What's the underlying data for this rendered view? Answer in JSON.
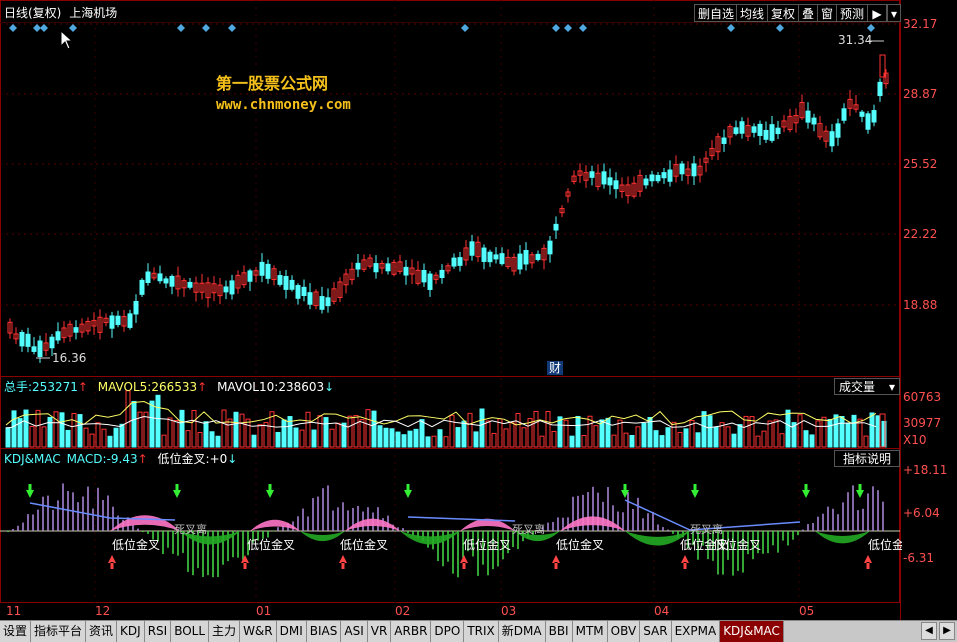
{
  "header": {
    "title": "日线(复权)",
    "stock": "上海机场"
  },
  "toolbar": {
    "del_self": "删自选",
    "ma_line": "均线",
    "fuquan": "复权",
    "overlay": "叠",
    "window": "窗",
    "forecast": "预测"
  },
  "watermark": {
    "line1": "第一股票公式网",
    "line2": "www.chnmoney.com"
  },
  "price_axis": [
    "32.17",
    "28.87",
    "25.52",
    "22.22",
    "18.88"
  ],
  "price_high_label": "31.34",
  "price_low_label": "16.36",
  "news_marker": "财",
  "volume": {
    "label": "总手:",
    "value": "253271",
    "ma5_label": "MAVOL5:",
    "ma5_value": "266533",
    "ma10_label": "MAVOL10:",
    "ma10_value": "238603",
    "dropdown": "成交量",
    "axis": [
      "60763",
      "30977",
      "X10"
    ]
  },
  "indicator": {
    "name": "KDJ&MAC",
    "macd_label": "MACD:",
    "macd_value": "-9.43",
    "cross_label": "低位金叉:",
    "cross_value": "+0",
    "explain": "指标说明",
    "axis": [
      "+18.11",
      "+6.04",
      "-6.31"
    ],
    "annotation": "低位金叉",
    "annotation_dup": "死叉离"
  },
  "time_axis": [
    "11",
    "12",
    "01",
    "02",
    "03",
    "04",
    "05"
  ],
  "tabs": [
    "设置",
    "指标平台",
    "资讯",
    "KDJ",
    "RSI",
    "BOLL",
    "主力",
    "W&R",
    "DMI",
    "BIAS",
    "ASI",
    "VR",
    "ARBR",
    "DPO",
    "TRIX",
    "新DMA",
    "BBI",
    "MTM",
    "OBV",
    "SAR",
    "EXPMA",
    "KDJ&MAC"
  ],
  "colors": {
    "up": "#ff3232",
    "down": "#54ffff",
    "accent_gold": "#f5c01a",
    "grid": "#8b0000",
    "pink": "#ff77c8",
    "green": "#22aa22"
  }
}
